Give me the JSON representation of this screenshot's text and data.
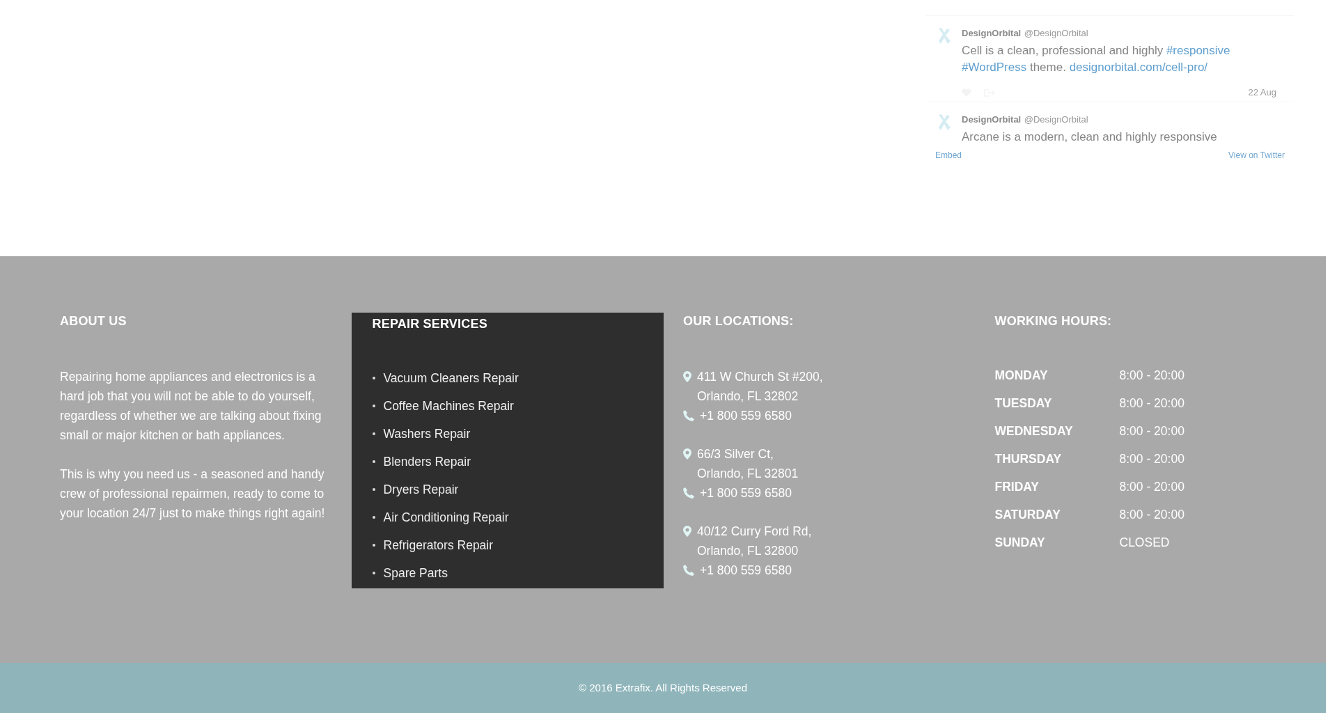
{
  "twitter_widget": {
    "tweets": [
      {
        "name": "DesignOrbital",
        "handle": "@DesignOrbital",
        "segments": [
          {
            "kind": "plain",
            "text": "Cell is a clean, professional and highly "
          },
          {
            "kind": "link",
            "text": "#responsive"
          },
          {
            "kind": "link",
            "text": "#WordPress"
          },
          {
            "kind": "plain",
            "text": " theme. "
          },
          {
            "kind": "link",
            "text": "designorbital.com/cell-pro/"
          }
        ],
        "date": "22 Aug"
      },
      {
        "name": "DesignOrbital",
        "handle": "@DesignOrbital",
        "segments": [
          {
            "kind": "plain",
            "text": "Arcane is a modern, clean and highly responsive"
          }
        ]
      }
    ],
    "links": [
      "Embed",
      "View on Twitter"
    ]
  },
  "footer": {
    "about": {
      "heading": "ABOUT US",
      "paragraphs": [
        "Repairing home appliances and electronics is a hard job that you will not be able to do yourself, regardless of whether we are talking about fixing small or major kitchen or bath appliances.",
        "This is why you need us - a seasoned and handy crew of professional repairmen, ready to come to your location 24/7 just to make things right again!"
      ]
    },
    "services": {
      "heading": "REPAIR SERVICES",
      "items": [
        "Vacuum Cleaners Repair",
        "Coffee Machines Repair",
        "Washers Repair",
        "Blenders Repair",
        "Dryers Repair",
        "Air Conditioning Repair",
        "Refrigerators Repair",
        "Spare Parts"
      ]
    },
    "locations": {
      "heading": "OUR LOCATIONS:",
      "items": [
        {
          "address": [
            "411 W Church St #200,",
            "Orlando, FL 32802"
          ],
          "phone": "+1 800 559 6580"
        },
        {
          "address": [
            "66/3 Silver Ct,",
            "Orlando, FL 32801"
          ],
          "phone": "+1 800 559 6580"
        },
        {
          "address": [
            "40/12 Curry Ford Rd,",
            "Orlando, FL 32800"
          ],
          "phone": "+1 800 559 6580"
        }
      ]
    },
    "hours": {
      "heading": "WORKING HOURS:",
      "rows": [
        {
          "day": "MONDAY",
          "time": "8:00 - 20:00"
        },
        {
          "day": "TUESDAY",
          "time": "8:00 - 20:00"
        },
        {
          "day": "WEDNESDAY",
          "time": "8:00 - 20:00"
        },
        {
          "day": "THURSDAY",
          "time": "8:00 - 20:00"
        },
        {
          "day": "FRIDAY",
          "time": "8:00 - 20:00"
        },
        {
          "day": "SATURDAY",
          "time": "8:00 - 20:00"
        },
        {
          "day": "SUNDAY",
          "time": "CLOSED"
        }
      ]
    }
  },
  "copyright": "© 2016 Extrafix. All Rights Reserved"
}
